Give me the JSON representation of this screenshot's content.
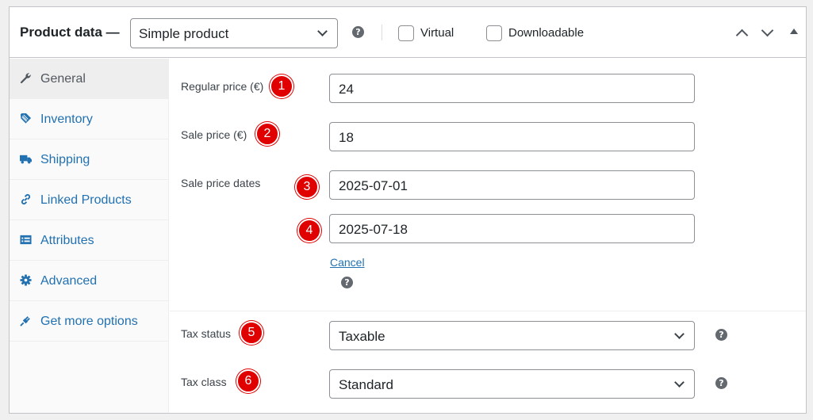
{
  "header": {
    "title": "Product data —",
    "product_type": "Simple product",
    "virtual_label": "Virtual",
    "downloadable_label": "Downloadable",
    "help_glyph": "?"
  },
  "tabs": [
    {
      "label": "General",
      "icon": "wrench-icon",
      "active": true
    },
    {
      "label": "Inventory",
      "icon": "tag-icon",
      "active": false
    },
    {
      "label": "Shipping",
      "icon": "truck-icon",
      "active": false
    },
    {
      "label": "Linked Products",
      "icon": "link-icon",
      "active": false
    },
    {
      "label": "Attributes",
      "icon": "list-icon",
      "active": false
    },
    {
      "label": "Advanced",
      "icon": "gear-icon",
      "active": false
    },
    {
      "label": "Get more options",
      "icon": "plug-icon",
      "active": false
    }
  ],
  "general": {
    "regular_price": {
      "label": "Regular price (€)",
      "value": "24"
    },
    "sale_price": {
      "label": "Sale price (€)",
      "value": "18"
    },
    "sale_price_dates": {
      "label": "Sale price dates",
      "from": "2025-07-01",
      "to": "2025-07-18",
      "cancel_label": "Cancel"
    },
    "tax_status": {
      "label": "Tax status",
      "value": "Taxable"
    },
    "tax_class": {
      "label": "Tax class",
      "value": "Standard"
    }
  },
  "annotations": [
    "1",
    "2",
    "3",
    "4",
    "5",
    "6"
  ],
  "colors": {
    "link": "#2271b1",
    "badge": "#e00000",
    "border": "#c3c4c7"
  }
}
